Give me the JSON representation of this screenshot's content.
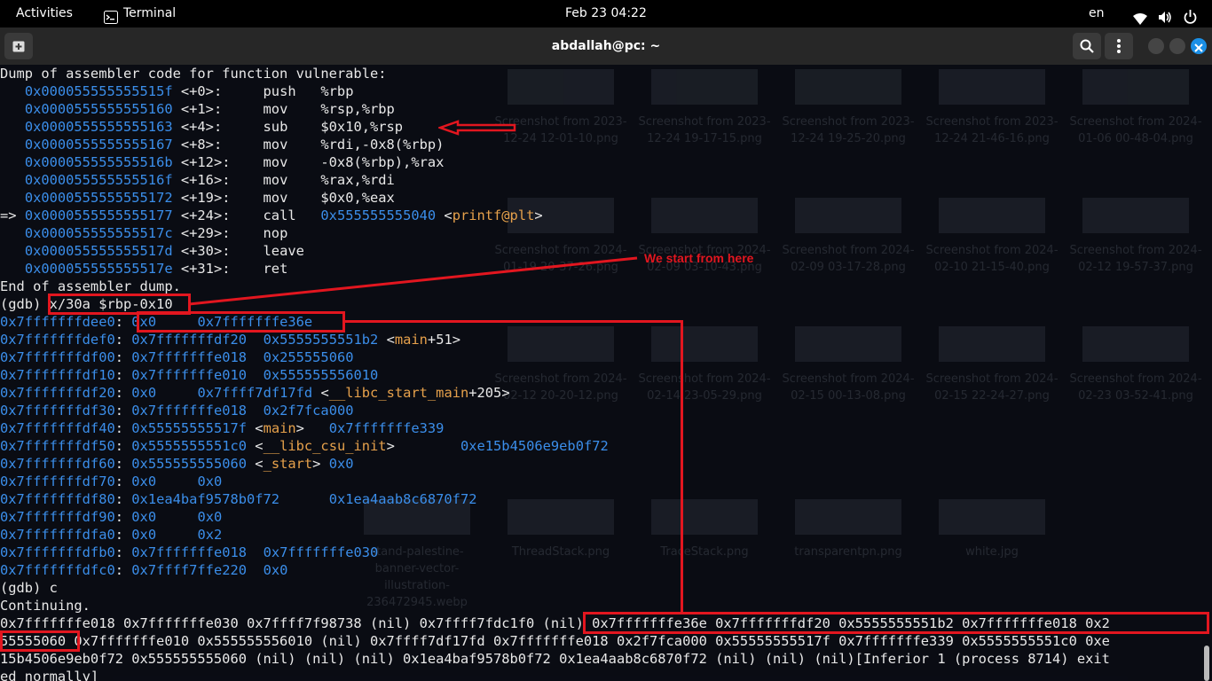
{
  "topbar": {
    "activities": "Activities",
    "app": "Terminal",
    "clock": "Feb 23  04:22",
    "lang": "en"
  },
  "window": {
    "title": "abdallah@pc: ~"
  },
  "colors": {
    "accent_red": "#e2161f",
    "address_blue": "#3b8eea",
    "symbol_orange": "#e6a14b",
    "close_button": "#1a8fe6"
  },
  "icons": [
    "new-tab-icon",
    "search-icon",
    "menu-icon",
    "minimize-icon",
    "maximize-icon",
    "close-icon",
    "wifi-icon",
    "volume-icon",
    "power-icon",
    "terminal-app-icon"
  ],
  "background_files": [
    {
      "name": "Screenshot from 2023-12-24 12-01-10.png"
    },
    {
      "name": "Screenshot from 2023-12-24 19-17-15.png"
    },
    {
      "name": "Screenshot from 2023-12-24 19-25-20.png"
    },
    {
      "name": "Screenshot from 2023-12-24 21-46-16.png"
    },
    {
      "name": "Screenshot from 2024-01-06 00-48-04.png"
    },
    {
      "name": "Screenshot from 2024-01-19 20-37-26.png"
    },
    {
      "name": "Screenshot from 2024-02-09 03-10-43.png"
    },
    {
      "name": "Screenshot from 2024-02-09 03-17-28.png"
    },
    {
      "name": "Screenshot from 2024-02-10 21-15-40.png"
    },
    {
      "name": "Screenshot from 2024-02-12 19-57-37.png"
    },
    {
      "name": "Screenshot from 2024-02-12 20-20-12.png"
    },
    {
      "name": "Screenshot from 2024-02-14 23-05-29.png"
    },
    {
      "name": "Screenshot from 2024-02-15 00-13-08.png"
    },
    {
      "name": "Screenshot from 2024-02-15 22-24-27.png"
    },
    {
      "name": "Screenshot from 2024-02-23 03-52-41.png"
    },
    {
      "name": "stand-palestine-banner-vector-illustration-236472945.webp"
    },
    {
      "name": "ThreadStack.png"
    },
    {
      "name": "TraceStack.png"
    },
    {
      "name": "transparentpn.png"
    },
    {
      "name": "white.jpg"
    }
  ],
  "annotation_text": "We start from here",
  "terminal": {
    "lines": [
      [
        {
          "t": "Dump of assembler code for function vulnerable:"
        }
      ],
      [
        {
          "t": "   "
        },
        {
          "t": "0x000055555555515f",
          "c": "addr"
        },
        {
          "t": " <+0>:     push   %rbp"
        }
      ],
      [
        {
          "t": "   "
        },
        {
          "t": "0x0000555555555160",
          "c": "addr"
        },
        {
          "t": " <+1>:     mov    %rsp,%rbp"
        }
      ],
      [
        {
          "t": "   "
        },
        {
          "t": "0x0000555555555163",
          "c": "addr"
        },
        {
          "t": " <+4>:     sub    $0x10,%rsp"
        }
      ],
      [
        {
          "t": "   "
        },
        {
          "t": "0x0000555555555167",
          "c": "addr"
        },
        {
          "t": " <+8>:     mov    %rdi,-0x8(%rbp)"
        }
      ],
      [
        {
          "t": "   "
        },
        {
          "t": "0x000055555555516b",
          "c": "addr"
        },
        {
          "t": " <+12>:    mov    -0x8(%rbp),%rax"
        }
      ],
      [
        {
          "t": "   "
        },
        {
          "t": "0x000055555555516f",
          "c": "addr"
        },
        {
          "t": " <+16>:    mov    %rax,%rdi"
        }
      ],
      [
        {
          "t": "   "
        },
        {
          "t": "0x0000555555555172",
          "c": "addr"
        },
        {
          "t": " <+19>:    mov    $0x0,%eax"
        }
      ],
      [
        {
          "t": "=> "
        },
        {
          "t": "0x0000555555555177",
          "c": "addr"
        },
        {
          "t": " <+24>:    call   "
        },
        {
          "t": "0x555555555040",
          "c": "addr"
        },
        {
          "t": " <"
        },
        {
          "t": "printf@plt",
          "c": "fn"
        },
        {
          "t": ">"
        }
      ],
      [
        {
          "t": "   "
        },
        {
          "t": "0x000055555555517c",
          "c": "addr"
        },
        {
          "t": " <+29>:    nop"
        }
      ],
      [
        {
          "t": "   "
        },
        {
          "t": "0x000055555555517d",
          "c": "addr"
        },
        {
          "t": " <+30>:    leave"
        }
      ],
      [
        {
          "t": "   "
        },
        {
          "t": "0x000055555555517e",
          "c": "addr"
        },
        {
          "t": " <+31>:    ret"
        }
      ],
      [
        {
          "t": "End of assembler dump."
        }
      ],
      [
        {
          "t": "(gdb) x/30a $rbp-0x10"
        }
      ],
      [
        {
          "t": "0x7fffffffdee0",
          "c": "addr"
        },
        {
          "t": ": "
        },
        {
          "t": "0x0",
          "c": "addr"
        },
        {
          "t": "     "
        },
        {
          "t": "0x7fffffffe36e",
          "c": "addr"
        }
      ],
      [
        {
          "t": "0x7fffffffdef0",
          "c": "addr"
        },
        {
          "t": ": "
        },
        {
          "t": "0x7fffffffdf20",
          "c": "addr"
        },
        {
          "t": "  "
        },
        {
          "t": "0x5555555551b2",
          "c": "addr"
        },
        {
          "t": " <"
        },
        {
          "t": "main",
          "c": "fn"
        },
        {
          "t": "+51>"
        }
      ],
      [
        {
          "t": "0x7fffffffdf00",
          "c": "addr"
        },
        {
          "t": ": "
        },
        {
          "t": "0x7fffffffe018",
          "c": "addr"
        },
        {
          "t": "  "
        },
        {
          "t": "0x255555060",
          "c": "addr"
        }
      ],
      [
        {
          "t": "0x7fffffffdf10",
          "c": "addr"
        },
        {
          "t": ": "
        },
        {
          "t": "0x7fffffffe010",
          "c": "addr"
        },
        {
          "t": "  "
        },
        {
          "t": "0x555555556010",
          "c": "addr"
        }
      ],
      [
        {
          "t": "0x7fffffffdf20",
          "c": "addr"
        },
        {
          "t": ": "
        },
        {
          "t": "0x0",
          "c": "addr"
        },
        {
          "t": "     "
        },
        {
          "t": "0x7ffff7df17fd",
          "c": "addr"
        },
        {
          "t": " <"
        },
        {
          "t": "__libc_start_main",
          "c": "fn"
        },
        {
          "t": "+205>"
        }
      ],
      [
        {
          "t": "0x7fffffffdf30",
          "c": "addr"
        },
        {
          "t": ": "
        },
        {
          "t": "0x7fffffffe018",
          "c": "addr"
        },
        {
          "t": "  "
        },
        {
          "t": "0x2f7fca000",
          "c": "addr"
        }
      ],
      [
        {
          "t": "0x7fffffffdf40",
          "c": "addr"
        },
        {
          "t": ": "
        },
        {
          "t": "0x55555555517f",
          "c": "addr"
        },
        {
          "t": " <"
        },
        {
          "t": "main",
          "c": "fn"
        },
        {
          "t": ">   "
        },
        {
          "t": "0x7fffffffe339",
          "c": "addr"
        }
      ],
      [
        {
          "t": "0x7fffffffdf50",
          "c": "addr"
        },
        {
          "t": ": "
        },
        {
          "t": "0x5555555551c0",
          "c": "addr"
        },
        {
          "t": " <"
        },
        {
          "t": "__libc_csu_init",
          "c": "fn"
        },
        {
          "t": ">        "
        },
        {
          "t": "0xe15b4506e9eb0f72",
          "c": "addr"
        }
      ],
      [
        {
          "t": "0x7fffffffdf60",
          "c": "addr"
        },
        {
          "t": ": "
        },
        {
          "t": "0x555555555060",
          "c": "addr"
        },
        {
          "t": " <"
        },
        {
          "t": "_start",
          "c": "fn"
        },
        {
          "t": "> "
        },
        {
          "t": "0x0",
          "c": "addr"
        }
      ],
      [
        {
          "t": "0x7fffffffdf70",
          "c": "addr"
        },
        {
          "t": ": "
        },
        {
          "t": "0x0",
          "c": "addr"
        },
        {
          "t": "     "
        },
        {
          "t": "0x0",
          "c": "addr"
        }
      ],
      [
        {
          "t": "0x7fffffffdf80",
          "c": "addr"
        },
        {
          "t": ": "
        },
        {
          "t": "0x1ea4baf9578b0f72",
          "c": "addr"
        },
        {
          "t": "      "
        },
        {
          "t": "0x1ea4aab8c6870f72",
          "c": "addr"
        }
      ],
      [
        {
          "t": "0x7fffffffdf90",
          "c": "addr"
        },
        {
          "t": ": "
        },
        {
          "t": "0x0",
          "c": "addr"
        },
        {
          "t": "     "
        },
        {
          "t": "0x0",
          "c": "addr"
        }
      ],
      [
        {
          "t": "0x7fffffffdfa0",
          "c": "addr"
        },
        {
          "t": ": "
        },
        {
          "t": "0x0",
          "c": "addr"
        },
        {
          "t": "     "
        },
        {
          "t": "0x2",
          "c": "addr"
        }
      ],
      [
        {
          "t": "0x7fffffffdfb0",
          "c": "addr"
        },
        {
          "t": ": "
        },
        {
          "t": "0x7fffffffe018",
          "c": "addr"
        },
        {
          "t": "  "
        },
        {
          "t": "0x7fffffffe030",
          "c": "addr"
        }
      ],
      [
        {
          "t": "0x7fffffffdfc0",
          "c": "addr"
        },
        {
          "t": ": "
        },
        {
          "t": "0x7ffff7ffe220",
          "c": "addr"
        },
        {
          "t": "  "
        },
        {
          "t": "0x0",
          "c": "addr"
        }
      ],
      [
        {
          "t": "(gdb) c"
        }
      ],
      [
        {
          "t": "Continuing."
        }
      ],
      [
        {
          "t": "0x7fffffffe018 0x7fffffffe030 0x7ffff7f98738 (nil) 0x7ffff7fdc1f0 (nil) 0x7fffffffe36e 0x7fffffffdf20 0x5555555551b2 0x7fffffffe018 0x2"
        }
      ],
      [
        {
          "t": "55555060 0x7fffffffe010 0x555555556010 (nil) 0x7ffff7df17fd 0x7fffffffe018 0x2f7fca000 0x55555555517f 0x7fffffffe339 0x5555555551c0 0xe"
        }
      ],
      [
        {
          "t": "15b4506e9eb0f72 0x555555555060 (nil) (nil) (nil) 0x1ea4baf9578b0f72 0x1ea4aab8c6870f72 (nil) (nil) (nil)[Inferior 1 (process 8714) exit"
        }
      ],
      [
        {
          "t": "ed normally]"
        }
      ]
    ]
  }
}
